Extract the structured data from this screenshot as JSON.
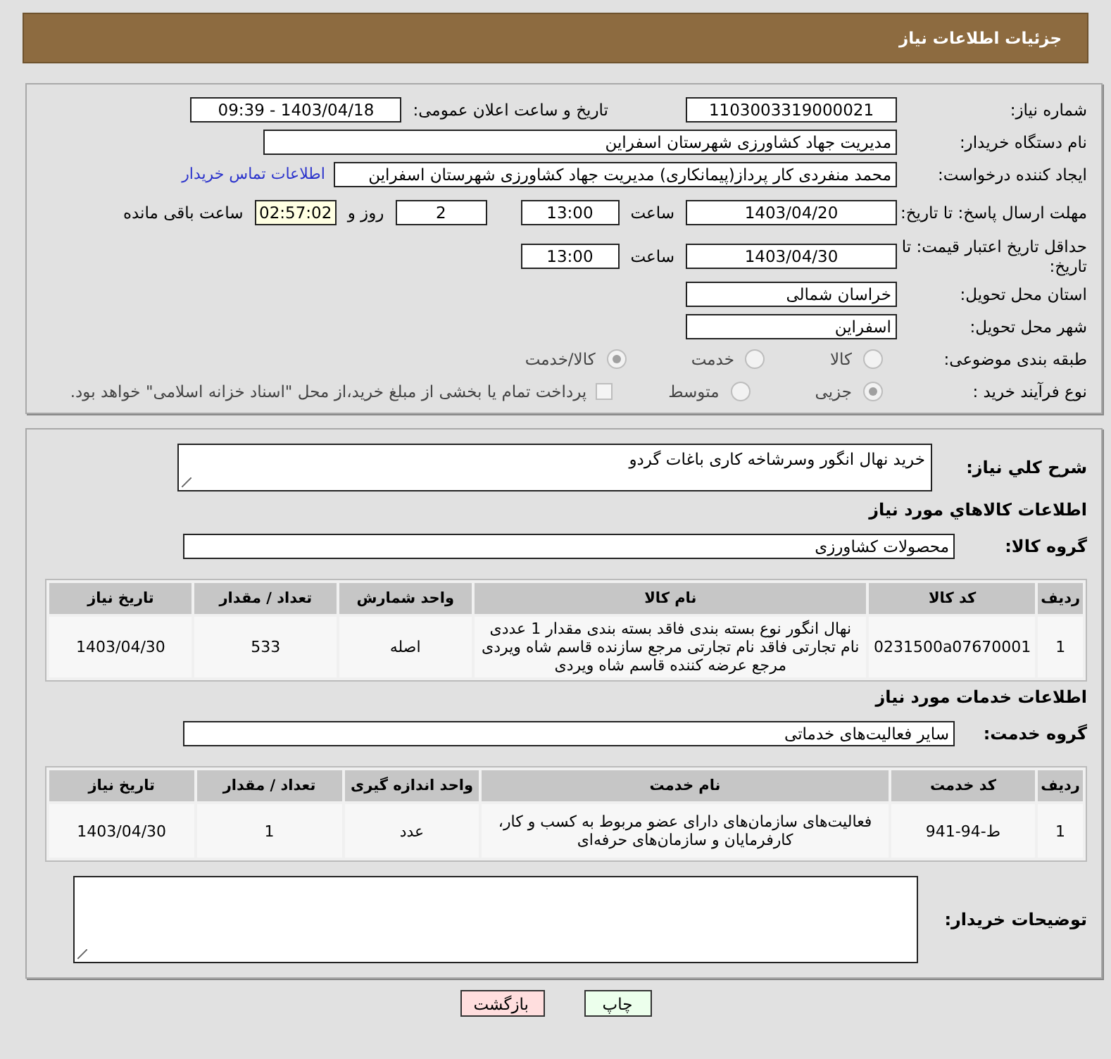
{
  "header": {
    "title": "جزئیات اطلاعات نیاز"
  },
  "details": {
    "need_number": {
      "label": "شماره نیاز:",
      "value": "1103003319000021"
    },
    "announce": {
      "label": "تاریخ و ساعت اعلان عمومی:",
      "value": "1403/04/18 - 09:39"
    },
    "buyer_org": {
      "label": "نام دستگاه خریدار:",
      "value": "مدیریت جهاد کشاورزی شهرستان اسفراین"
    },
    "requester": {
      "label": "ایجاد کننده درخواست:",
      "value": "محمد  منفردی کار پرداز(پیمانکاری) مدیریت جهاد کشاورزی شهرستان اسفراین",
      "link": "اطلاعات تماس خریدار"
    },
    "reply_deadline": {
      "label": "مهلت ارسال پاسخ: تا تاریخ:",
      "date": "1403/04/20",
      "time_label": "ساعت",
      "time": "13:00",
      "days": "2",
      "days_label": "روز و",
      "remaining": "02:57:02",
      "remaining_label": "ساعت باقی مانده"
    },
    "price_validity": {
      "label": "حداقل تاریخ اعتبار قیمت: تا تاریخ:",
      "date": "1403/04/30",
      "time_label": "ساعت",
      "time": "13:00"
    },
    "province": {
      "label": "استان محل تحویل:",
      "value": "خراسان شمالی"
    },
    "city": {
      "label": "شهر محل تحویل:",
      "value": "اسفراین"
    },
    "category": {
      "label": "طبقه بندی موضوعی:",
      "options": [
        {
          "label": "کالا",
          "selected": false
        },
        {
          "label": "خدمت",
          "selected": false
        },
        {
          "label": "کالا/خدمت",
          "selected": true
        }
      ]
    },
    "process": {
      "label": "نوع فرآیند خرید :",
      "options": [
        {
          "label": "جزیی",
          "selected": true
        },
        {
          "label": "متوسط",
          "selected": false
        }
      ],
      "payment": {
        "checked": false,
        "label": "پرداخت تمام یا بخشی از مبلغ خرید،از محل \"اسناد خزانه اسلامی\" خواهد بود."
      }
    }
  },
  "description": {
    "label": "شرح کلي نياز:",
    "value": "خرید نهال انگور وسرشاخه کاری باغات گردو"
  },
  "goods": {
    "title": "اطلاعات کالاهاي مورد نياز",
    "group_label": "گروه کالا:",
    "group_value": "محصولات کشاورزی",
    "columns": [
      "ردیف",
      "کد کالا",
      "نام کالا",
      "واحد شمارش",
      "تعداد / مقدار",
      "تاریخ نیاز"
    ],
    "rows": [
      [
        "1",
        "0231500a07670001",
        "نهال انگور نوع بسته بندی فاقد بسته بندی مقدار 1 عددی نام تجارتی فاقد نام تجارتی مرجع سازنده قاسم شاه ویردی مرجع عرضه کننده قاسم شاه ویردی",
        "اصله",
        "533",
        "1403/04/30"
      ]
    ]
  },
  "services": {
    "title": "اطلاعات خدمات مورد نیاز",
    "group_label": "گروه خدمت:",
    "group_value": "سایر فعالیت‌های خدماتی",
    "columns": [
      "ردیف",
      "کد خدمت",
      "نام خدمت",
      "واحد اندازه گیری",
      "تعداد / مقدار",
      "تاریخ نیاز"
    ],
    "rows": [
      [
        "1",
        "ط-94-941",
        "فعالیت‌های سازمان‌های دارای عضو مربوط به کسب و کار، کارفرمایان و سازمان‌های حرفه‌ای",
        "عدد",
        "1",
        "1403/04/30"
      ]
    ]
  },
  "buyer_notes": {
    "label": "توضیحات خریدار:"
  },
  "buttons": [
    {
      "label": "چاپ",
      "kind": "print"
    },
    {
      "label": "بازگشت",
      "kind": "back"
    }
  ]
}
